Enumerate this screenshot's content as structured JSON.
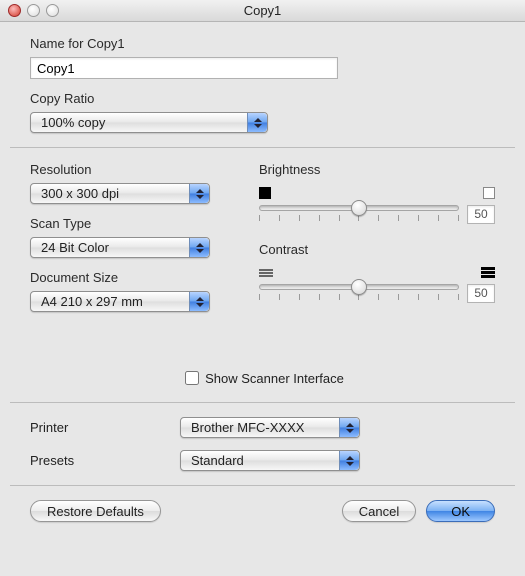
{
  "window": {
    "title": "Copy1"
  },
  "name_field": {
    "label": "Name for Copy1",
    "value": "Copy1"
  },
  "copy_ratio": {
    "label": "Copy Ratio",
    "value": "100% copy"
  },
  "resolution": {
    "label": "Resolution",
    "value": "300 x 300 dpi"
  },
  "scan_type": {
    "label": "Scan Type",
    "value": "24 Bit Color"
  },
  "document_size": {
    "label": "Document Size",
    "value": "A4  210 x 297 mm"
  },
  "brightness": {
    "label": "Brightness",
    "value": "50"
  },
  "contrast": {
    "label": "Contrast",
    "value": "50"
  },
  "show_scanner_interface": {
    "label": "Show Scanner Interface",
    "checked": false
  },
  "printer": {
    "label": "Printer",
    "value": "Brother MFC-XXXX"
  },
  "presets": {
    "label": "Presets",
    "value": "Standard"
  },
  "buttons": {
    "restore_defaults": "Restore Defaults",
    "cancel": "Cancel",
    "ok": "OK"
  },
  "chart_data": null
}
